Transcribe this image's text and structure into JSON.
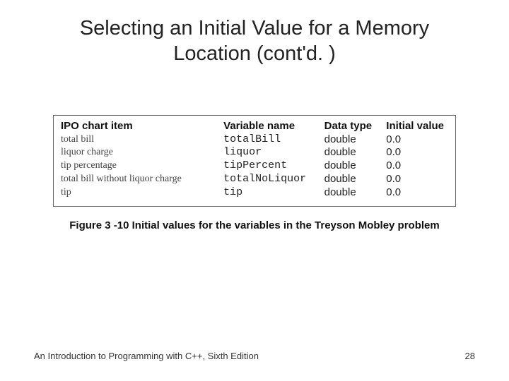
{
  "title_line1": "Selecting an Initial Value for a Memory",
  "title_line2": "Location (cont'd. )",
  "table": {
    "headers": {
      "item": "IPO chart item",
      "varname": "Variable name",
      "datatype": "Data type",
      "initval": "Initial value"
    },
    "rows": [
      {
        "item": "total bill",
        "varname": "totalBill",
        "datatype": "double",
        "initval": "0.0"
      },
      {
        "item": "liquor charge",
        "varname": "liquor",
        "datatype": "double",
        "initval": "0.0"
      },
      {
        "item": "tip percentage",
        "varname": "tipPercent",
        "datatype": "double",
        "initval": "0.0"
      },
      {
        "item": "total bill without liquor charge",
        "varname": "totalNoLiquor",
        "datatype": "double",
        "initval": "0.0"
      },
      {
        "item": "tip",
        "varname": "tip",
        "datatype": "double",
        "initval": "0.0"
      }
    ]
  },
  "caption": "Figure 3 -10 Initial values for the variables in the Treyson Mobley problem",
  "footer": {
    "book": "An Introduction to Programming with C++, Sixth Edition",
    "page": "28"
  }
}
